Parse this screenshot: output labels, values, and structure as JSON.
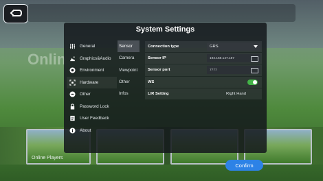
{
  "dialog": {
    "title": "System Settings",
    "menu": [
      {
        "label": "General",
        "icon": "sliders-icon"
      },
      {
        "label": "Graphics&Audio",
        "icon": "image-icon"
      },
      {
        "label": "Environment",
        "icon": "eye-icon"
      },
      {
        "label": "Hardware",
        "icon": "expand-icon"
      },
      {
        "label": "Other",
        "icon": "more-icon"
      },
      {
        "label": "Password Lock",
        "icon": "lock-icon"
      },
      {
        "label": "User Feedback",
        "icon": "document-icon"
      },
      {
        "label": "About",
        "icon": "info-icon"
      }
    ],
    "active_menu": "Hardware",
    "submenu": [
      "Sensor",
      "Camera",
      "Viewpoint",
      "Other",
      "Infos"
    ],
    "active_submenu": "Sensor",
    "settings": {
      "connection_type_label": "Connection type",
      "connection_type_value": "GRS",
      "sensor_ip_label": "Sensor IP",
      "sensor_ip_value": "192.168.147.187",
      "sensor_port_label": "Sensor port",
      "sensor_port_value": "7777",
      "ws_label": "WS",
      "ws_enabled": true,
      "lr_label": "L/R Setting",
      "lr_value": "Right Hand"
    },
    "confirm_label": "Confirm"
  },
  "background": {
    "online_text": "Onlin",
    "thumb_label": "Online Players"
  },
  "colors": {
    "accent": "#2d82e6",
    "toggle_on": "#43b347",
    "dialog_bg": "#14181c"
  }
}
